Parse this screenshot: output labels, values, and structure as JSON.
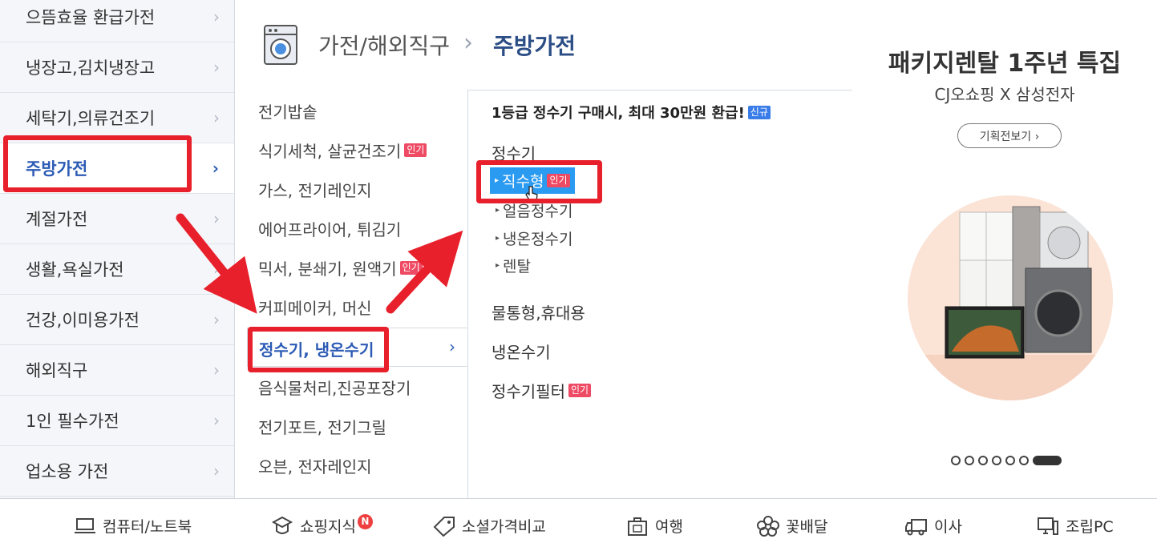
{
  "sidebar": {
    "items": [
      {
        "label": "으뜸효율 환급가전"
      },
      {
        "label": "냉장고,김치냉장고"
      },
      {
        "label": "세탁기,의류건조기"
      },
      {
        "label": "주방가전"
      },
      {
        "label": "계절가전"
      },
      {
        "label": "생활,욕실가전"
      },
      {
        "label": "건강,이미용가전"
      },
      {
        "label": "해외직구"
      },
      {
        "label": "1인 필수가전"
      },
      {
        "label": "업소용 가전"
      }
    ],
    "active_index": 3,
    "chevron": "›"
  },
  "header": {
    "icon": "washing-machine-icon",
    "parent": "가전/해외직구",
    "separator": "›",
    "current": "주방가전"
  },
  "subcategories": {
    "items": [
      {
        "label": "전기밥솥",
        "tag": ""
      },
      {
        "label": "식기세척, 살균건조기",
        "tag": "인기"
      },
      {
        "label": "가스, 전기레인지",
        "tag": ""
      },
      {
        "label": "에어프라이어, 튀김기",
        "tag": ""
      },
      {
        "label": "믹서, 분쇄기, 원액기",
        "tag": "인기"
      },
      {
        "label": "커피메이커, 머신",
        "tag": ""
      },
      {
        "label": "정수기, 냉온수기",
        "tag": ""
      },
      {
        "label": "음식물처리,진공포장기",
        "tag": ""
      },
      {
        "label": "전기포트, 전기그릴",
        "tag": ""
      },
      {
        "label": "오븐, 전자레인지",
        "tag": ""
      }
    ],
    "active_label": "정수기, 냉온수기",
    "chevron": "›"
  },
  "detail": {
    "promo": "1등급 정수기 구매시, 최대 30만원 환급!",
    "promo_tag": "신규",
    "groups": {
      "water_purifier": "정수기",
      "bottle": "물통형,휴대용",
      "cooler": "냉온수기",
      "filter": "정수기필터",
      "filter_tag": "인기"
    },
    "links": {
      "direct": "직수형",
      "direct_tag": "인기",
      "ice": "얼음정수기",
      "hotcold": "냉온정수기",
      "rental": "렌탈"
    },
    "triangle": "▸"
  },
  "banner": {
    "title": "패키지렌탈 1주년 특집",
    "subtitle": "CJ오쇼핑 X 삼성전자",
    "button": "기획전보기 ›",
    "slides_total": 7,
    "active_slide": 7
  },
  "bottom_bar": {
    "items": [
      {
        "label": "컴퓨터/노트북",
        "icon": "laptop-icon"
      },
      {
        "label": "쇼핑지식",
        "icon": "shopping-knowledge-icon",
        "badge": "N"
      },
      {
        "label": "소셜가격비교",
        "icon": "price-tag-icon"
      },
      {
        "label": "여행",
        "icon": "suitcase-icon"
      },
      {
        "label": "꽃배달",
        "icon": "flower-icon"
      },
      {
        "label": "이사",
        "icon": "truck-icon"
      },
      {
        "label": "조립PC",
        "icon": "desktop-pc-icon"
      }
    ]
  },
  "colors": {
    "accent_blue": "#2c5bb5",
    "highlight": "#2b9bf2",
    "tag_red": "#ef4a63",
    "annotation_red": "#e8202b"
  }
}
